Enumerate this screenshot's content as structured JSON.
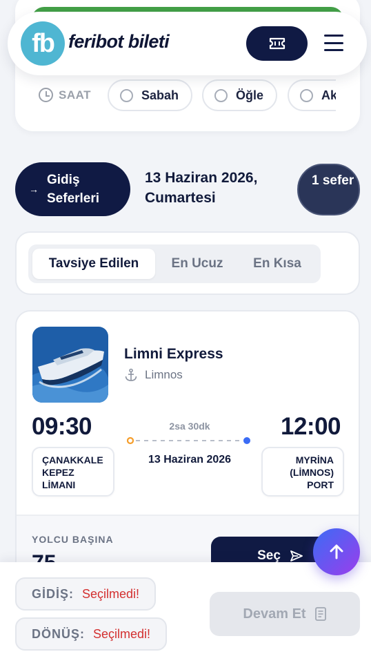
{
  "header": {
    "logo_mark": "fb",
    "logo_text": "feribot bileti",
    "ticket_icon": "ticket-icon",
    "menu_icon": "hamburger-menu-icon"
  },
  "time_filter": {
    "label": "SAAT",
    "options": [
      {
        "label": "Sabah",
        "selected": false
      },
      {
        "label": "Öğle",
        "selected": false
      },
      {
        "label": "Ak",
        "selected": false
      }
    ]
  },
  "results_header": {
    "direction_label": "Gidiş Seferleri",
    "date": "13 Haziran 2026, Cumartesi",
    "count": "1 sefer"
  },
  "sort_tabs": [
    {
      "label": "Tavsiye Edilen",
      "active": true
    },
    {
      "label": "En Ucuz",
      "active": false
    },
    {
      "label": "En Kısa",
      "active": false
    }
  ],
  "trip": {
    "ship_name": "Limni Express",
    "destination": "Limnos",
    "departure_time": "09:30",
    "arrival_time": "12:00",
    "duration": "2sa 30dk",
    "date": "13 Haziran 2026",
    "departure_port": "ÇANAKKALE KEPEZ LİMANI",
    "arrival_port": "MYRİNA (LİMNOS) PORT",
    "price_label": "YOLCU BAŞINA",
    "price_partial": "75",
    "select_label": "Seç"
  },
  "bottom_bar": {
    "gidis_key": "GİDİŞ:",
    "gidis_value": "Seçilmedi!",
    "donus_key": "DÖNÜŞ:",
    "donus_value": "Seçilmedi!",
    "continue_label": "Devam Et"
  },
  "colors": {
    "navy": "#101a44",
    "accent_blue": "#3b6cf5",
    "accent_purple": "#9b3dec",
    "error_red": "#d32f2f",
    "origin_orange": "#f59e2c",
    "logo_teal": "#4fb6d2"
  }
}
